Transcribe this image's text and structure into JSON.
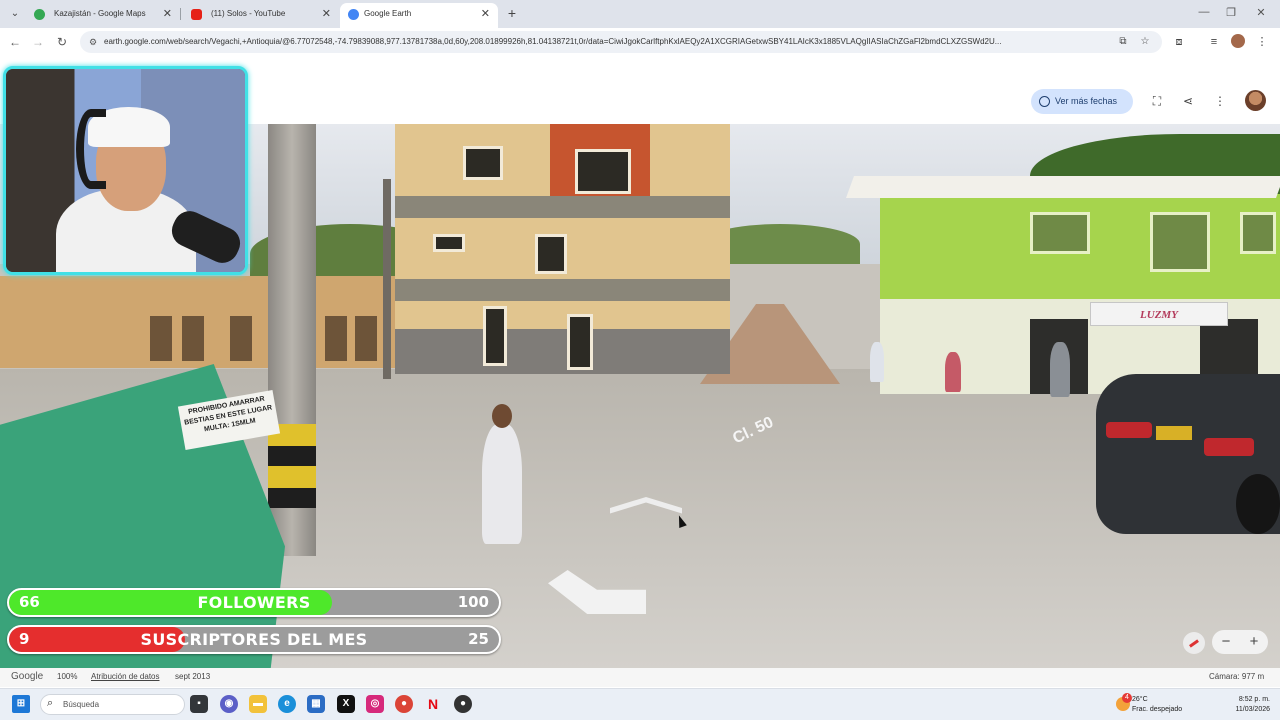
{
  "browser": {
    "tabs": [
      {
        "title": "Kazajistán - Google Maps",
        "active": false,
        "favicon": "maps-pin-icon"
      },
      {
        "title": "(11) Solos - YouTube",
        "active": false,
        "favicon": "youtube-icon"
      },
      {
        "title": "Google Earth",
        "active": true,
        "favicon": "earth-icon"
      }
    ],
    "url": "earth.google.com/web/search/Vegachi,+Antioquia/@6.77072548,-74.79839088,977.13781738a,0d,60y,208.01899926h,81.04138721t,0r/data=CiwiJgokCarlftphKxlAEQy2A1XCGRIAGetxwSBY41LAIcK3x1885VLAQgIIASIaChZGaFl2bmdCLXZGSWd2U..."
  },
  "earth": {
    "dates_button": "Ver más fechas",
    "colors": {
      "accent": "#d3e3fd",
      "accent_text": "#1f3f6f"
    }
  },
  "street_view": {
    "sign_prohibido": "PROHIBIDO AMARRAR BESTIAS EN ESTE LUGAR MULTA: 1SMLM",
    "store_sign": "LUZMY",
    "road_marking": "Cl. 50"
  },
  "overlay": {
    "followers": {
      "current": "66",
      "label": "FOLLOWERS",
      "goal": "100",
      "progress": 0.66,
      "color": "#4ee82a"
    },
    "subscribers": {
      "current": "9",
      "label": "SUSCRIPTORES DEL MES",
      "goal": "25",
      "progress": 0.36,
      "color": "#e52e2e"
    }
  },
  "footer": {
    "brand": "Google",
    "zoom": "100%",
    "attribution": "Atribución de datos",
    "date": "sept 2013",
    "camera": "Cámara: 977 m"
  },
  "controls": {
    "zoom_out": "−",
    "zoom_in": "+"
  },
  "taskbar": {
    "search_placeholder": "Búsqueda",
    "weather_badge": "4",
    "temperature": "26°C",
    "weather_desc": "Frac. despejado",
    "time": "8:52 p. m.",
    "date": "11/03/2026"
  }
}
